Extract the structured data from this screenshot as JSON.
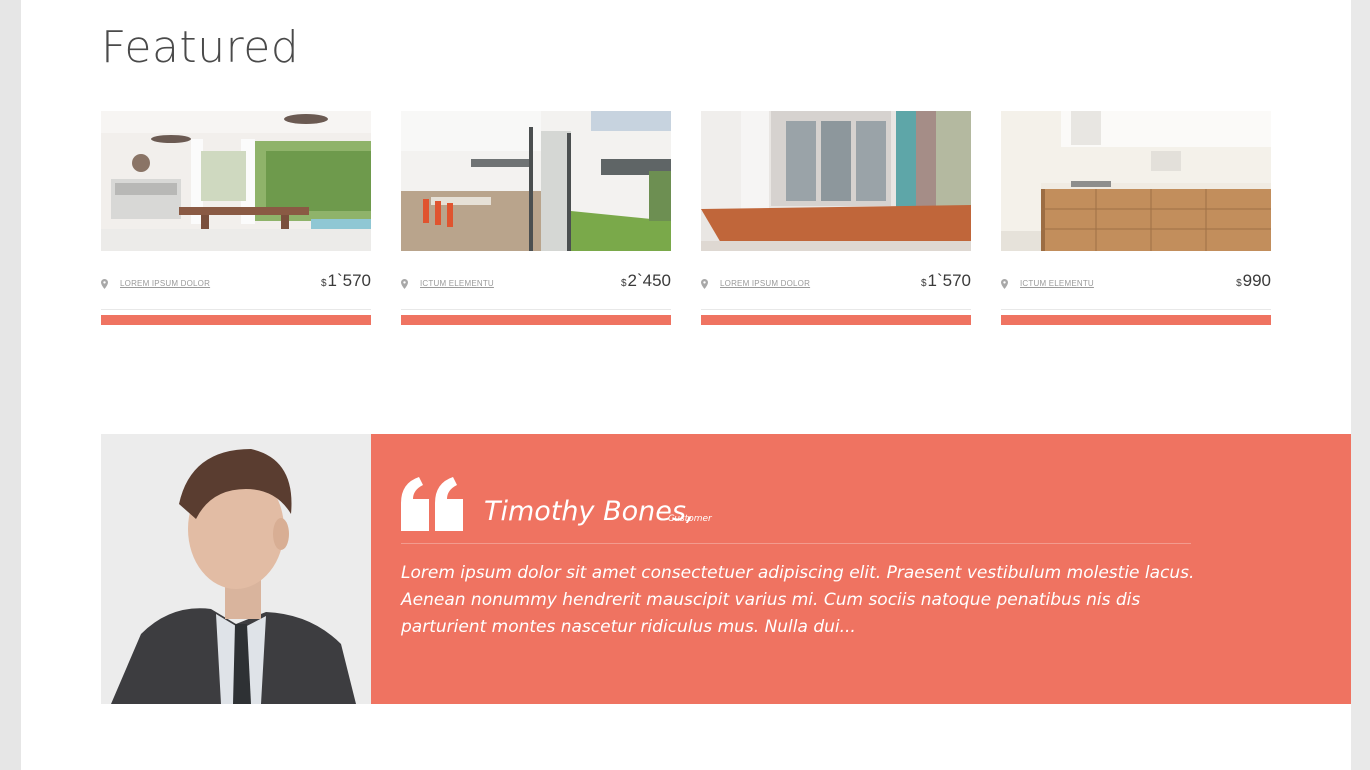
{
  "section": {
    "title": "Featured"
  },
  "listings": [
    {
      "location": "LOREM IPSUM DOLOR",
      "currency": "$",
      "price": "1`570",
      "photo_icon": "outdoor-patio-photo"
    },
    {
      "location": "ICTUM ELEMENTU",
      "currency": "$",
      "price": "2`450",
      "photo_icon": "dining-room-photo"
    },
    {
      "location": "LOREM IPSUM DOLOR",
      "currency": "$",
      "price": "1`570",
      "photo_icon": "house-deck-photo"
    },
    {
      "location": "ICTUM ELEMENTU",
      "currency": "$",
      "price": "990",
      "photo_icon": "kitchen-photo"
    }
  ],
  "testimonial": {
    "name": "Timothy Bones,",
    "role": "Customer",
    "text": "Lorem ipsum dolor sit amet consectetuer adipiscing elit. Praesent vestibulum molestie lacus. Aenean nonummy hendrerit mauscipit varius mi. Cum sociis natoque penatibus nis dis parturient montes nascetur ridiculus mus. Nulla dui..."
  },
  "colors": {
    "accent": "#ef7361",
    "text_dark": "#3a3a3a",
    "muted": "#9a9a9a"
  }
}
